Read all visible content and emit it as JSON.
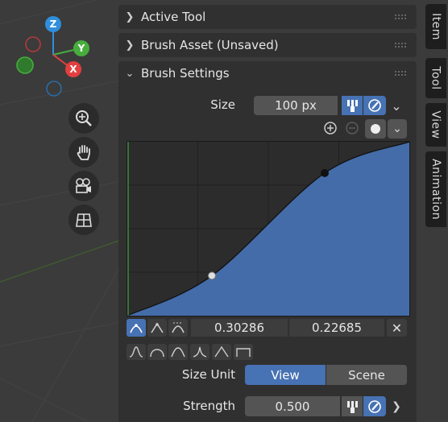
{
  "gizmo": {
    "z_label": "Z",
    "y_label": "Y",
    "x_label": "X",
    "colors": {
      "x": "#e33f3f",
      "y": "#47ad3d",
      "z": "#2f8fdc"
    }
  },
  "nav_buttons": [
    {
      "name": "zoom-icon"
    },
    {
      "name": "hand-pan-icon"
    },
    {
      "name": "camera-icon"
    },
    {
      "name": "ortho-grid-icon"
    }
  ],
  "sidebar_tabs": [
    "Item",
    "Tool",
    "View",
    "Animation"
  ],
  "panels": {
    "active_tool": "Active Tool",
    "brush_asset": "Brush Asset (Unsaved)",
    "brush_settings": "Brush Settings"
  },
  "size": {
    "label": "Size",
    "value": "100 px"
  },
  "curve": {
    "selected_x": "0.30286",
    "selected_y": "0.22685",
    "points": [
      [
        0,
        0
      ],
      [
        0.3,
        0.23
      ],
      [
        0.7,
        0.82
      ],
      [
        1,
        1
      ]
    ]
  },
  "size_unit": {
    "label": "Size Unit",
    "options": [
      "View",
      "Scene"
    ],
    "selected": "View"
  },
  "strength": {
    "label": "Strength",
    "value": "0.500"
  },
  "accent_color": "#4772b3"
}
